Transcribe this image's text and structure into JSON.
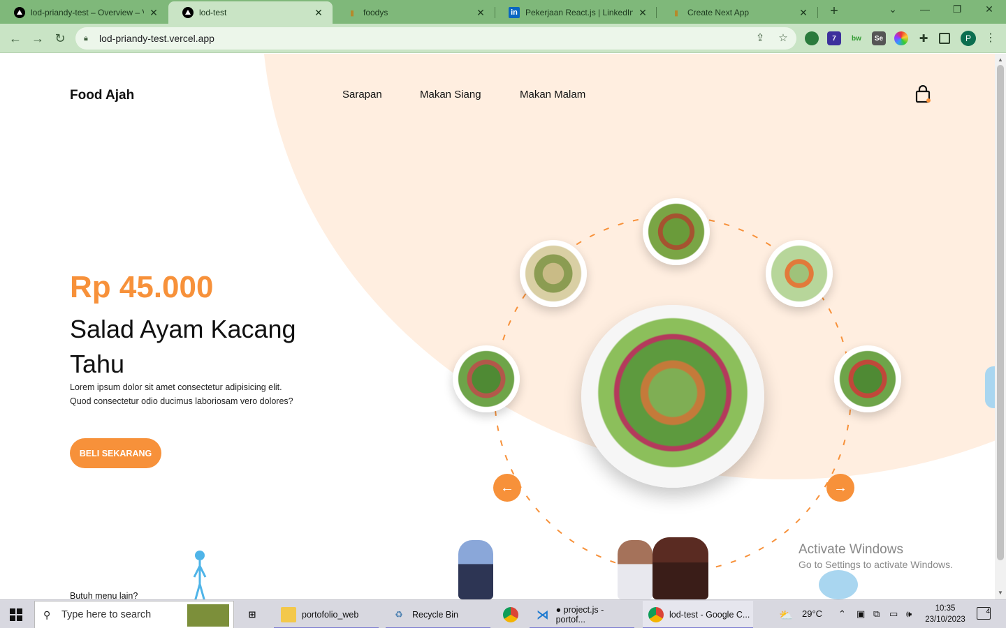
{
  "browser": {
    "tabs": [
      {
        "title": "lod-priandy-test – Overview – V",
        "favicon": "vercel-icon"
      },
      {
        "title": "lod-test",
        "favicon": "vercel-icon",
        "active": true
      },
      {
        "title": "foodys",
        "favicon": "food-icon"
      },
      {
        "title": "Pekerjaan React.js | LinkedIn",
        "favicon": "linkedin-icon"
      },
      {
        "title": "Create Next App",
        "favicon": "food-icon"
      }
    ],
    "url": "lod-priandy-test.vercel.app",
    "profile_initial": "P",
    "extensions": [
      "globe-extension-icon",
      "hat-extension-icon",
      "bw-extension-icon",
      "se-extension-icon",
      "color-extension-icon",
      "puzzle-icon",
      "sidepanel-icon"
    ],
    "ext_labels": {
      "badge": "7",
      "bw": "bw",
      "se": "Se"
    }
  },
  "page": {
    "brand": "Food Ajah",
    "nav": [
      "Sarapan",
      "Makan Siang",
      "Makan Malam"
    ],
    "price": "Rp 45.000",
    "dish_name": "Salad Ayam Kacang Tahu",
    "description": "Lorem ipsum dolor sit amet consectetur adipisicing elit. Quod consectetur odio ducimus laboriosam vero dolores?",
    "buy_button": "BELI SEKARANG",
    "more_menu": "Butuh menu lain?",
    "prev_icon": "arrow-left-icon",
    "next_icon": "arrow-right-icon",
    "accent_color": "#f7913a",
    "blob_color": "#ffeee0"
  },
  "watermark": {
    "line1": "Activate Windows",
    "line2": "Go to Settings to activate Windows."
  },
  "taskbar": {
    "search_placeholder": "Type here to search",
    "items": [
      {
        "label": "portofolio_web",
        "icon": "folder-icon"
      },
      {
        "label": "Recycle Bin",
        "icon": "recycle-bin-icon"
      },
      {
        "label": "",
        "icon": "chrome-icon"
      },
      {
        "label": "● project.js - portof...",
        "icon": "vscode-icon"
      },
      {
        "label": "lod-test - Google C...",
        "icon": "chrome-icon"
      }
    ],
    "weather": "29°C",
    "time": "10:35",
    "date": "23/10/2023",
    "notifications": "4"
  }
}
